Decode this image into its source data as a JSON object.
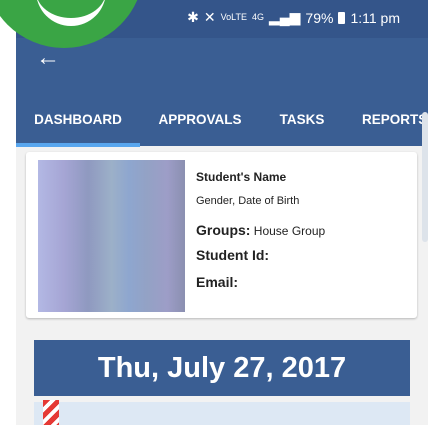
{
  "status_bar": {
    "network_small_1": "VoLTE",
    "network_small_2": "4G",
    "battery": "79%",
    "time": "1:11 pm"
  },
  "app_bar": {
    "back_icon": "arrow-left-icon"
  },
  "tabs": [
    {
      "label": "DASHBOARD",
      "selected": true
    },
    {
      "label": "APPROVALS",
      "selected": false
    },
    {
      "label": "TASKS",
      "selected": false
    },
    {
      "label": "REPORTS",
      "selected": false
    }
  ],
  "student": {
    "name": "Student's Name",
    "gender_dob": "Gender, Date of Birth",
    "groups_label": "Groups:",
    "groups_value": "House Group",
    "id_label": "Student Id:",
    "email_label": "Email:"
  },
  "date_banner": "Thu, July 27, 2017",
  "colors": {
    "primary": "#3a5e93",
    "tab_indicator": "#58a6ee",
    "green_accent": "#3aa545"
  }
}
